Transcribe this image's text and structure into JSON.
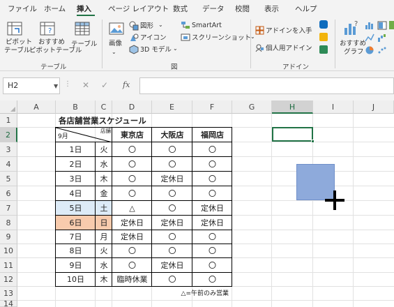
{
  "ribbon_tabs": [
    "ファイル",
    "ホーム",
    "挿入",
    "ページ レイアウト",
    "数式",
    "データ",
    "校閲",
    "表示",
    "ヘルプ"
  ],
  "active_tab": "挿入",
  "ribbon": {
    "pivot_table": [
      "ピボット",
      "テーブル"
    ],
    "recommended_pivot": [
      "おすすめ",
      "ピボットテーブル"
    ],
    "table": "テーブル",
    "tables_group": "テーブル",
    "images": "画像",
    "shapes": "図形",
    "icons": "アイコン",
    "models_3d": "3D モデル",
    "smartart": "SmartArt",
    "screenshot": "スクリーンショット",
    "illustrations_group": "図",
    "get_addins": "アドインを入手",
    "my_addins": "個人用アドイン",
    "addins_group": "アドイン",
    "recommended_charts": [
      "おすすめ",
      "グラフ"
    ]
  },
  "formula_bar": {
    "name_box": "H2",
    "fx": "fx",
    "formula": ""
  },
  "columns": [
    "A",
    "B",
    "C",
    "D",
    "E",
    "F",
    "G",
    "H",
    "I",
    "J"
  ],
  "rows": [
    "1",
    "2",
    "3",
    "4",
    "5",
    "6",
    "7",
    "8",
    "9",
    "10",
    "11",
    "12",
    "13",
    "14"
  ],
  "selected_cell": "H2",
  "sheet": {
    "title": "各店舗営業スケジュール",
    "header_month": "9月",
    "header_store": "店舗",
    "stores": [
      "東京店",
      "大阪店",
      "福岡店"
    ],
    "schedule": [
      {
        "date": "1日",
        "day": "火",
        "tokyo": "〇",
        "osaka": "〇",
        "fukuoka": "〇"
      },
      {
        "date": "2日",
        "day": "水",
        "tokyo": "〇",
        "osaka": "〇",
        "fukuoka": "〇"
      },
      {
        "date": "3日",
        "day": "木",
        "tokyo": "〇",
        "osaka": "定休日",
        "fukuoka": "〇"
      },
      {
        "date": "4日",
        "day": "金",
        "tokyo": "〇",
        "osaka": "〇",
        "fukuoka": "〇"
      },
      {
        "date": "5日",
        "day": "土",
        "tokyo": "△",
        "osaka": "〇",
        "fukuoka": "定休日"
      },
      {
        "date": "6日",
        "day": "日",
        "tokyo": "定休日",
        "osaka": "定休日",
        "fukuoka": "定休日"
      },
      {
        "date": "7日",
        "day": "月",
        "tokyo": "定休日",
        "osaka": "〇",
        "fukuoka": "〇"
      },
      {
        "date": "8日",
        "day": "火",
        "tokyo": "〇",
        "osaka": "〇",
        "fukuoka": "〇"
      },
      {
        "date": "9日",
        "day": "水",
        "tokyo": "〇",
        "osaka": "定休日",
        "fukuoka": "〇"
      },
      {
        "date": "10日",
        "day": "木",
        "tokyo": "臨時休業",
        "osaka": "〇",
        "fukuoka": "〇"
      }
    ],
    "note": "△=午前のみ営業"
  },
  "colors": {
    "accent": "#217346",
    "saturday_fill": "#ddebf7",
    "sunday_fill": "#f8cbad",
    "shape_fill": "#8eaadb"
  }
}
